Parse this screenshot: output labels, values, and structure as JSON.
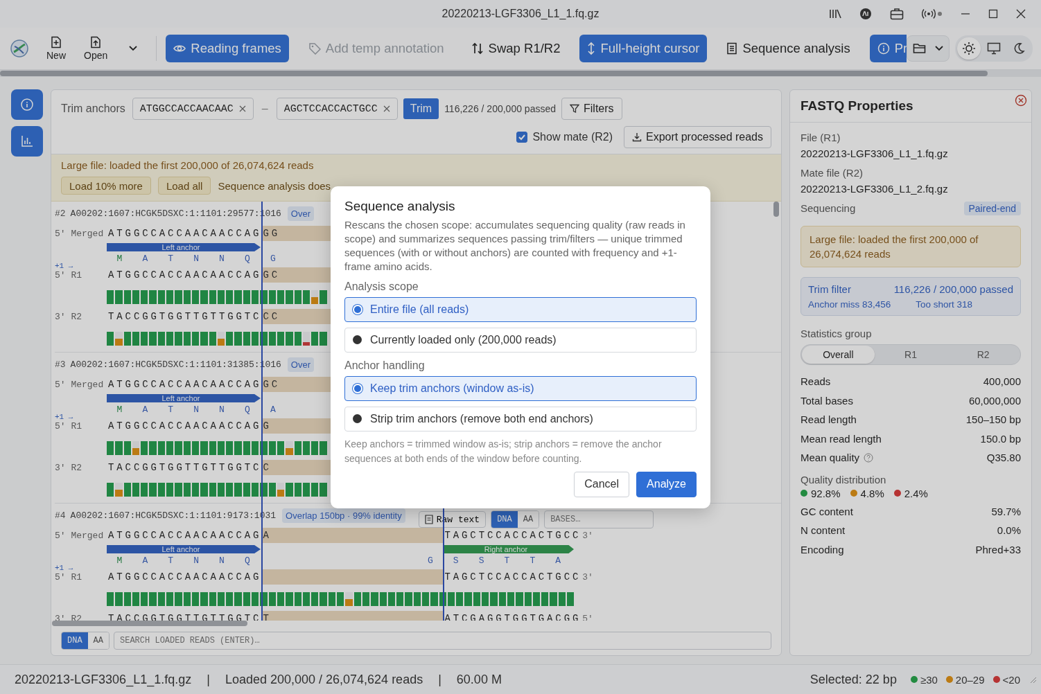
{
  "window": {
    "title": "20220213-LGF3306_L1_1.fq.gz"
  },
  "toolbar": {
    "file_buttons": [
      {
        "label": "New"
      },
      {
        "label": "Open"
      }
    ],
    "actions": [
      {
        "label": "Reading frames",
        "on": true,
        "disabled": false
      },
      {
        "label": "Add temp annotation",
        "on": false,
        "disabled": true
      },
      {
        "label": "Swap R1/R2",
        "on": false,
        "disabled": false
      },
      {
        "label": "Full-height cursor",
        "on": true,
        "disabled": false
      },
      {
        "label": "Sequence analysis",
        "on": false,
        "disabled": false
      },
      {
        "label": "Pr",
        "on": true,
        "disabled": false
      }
    ],
    "themes": [
      {
        "selected": true
      },
      {
        "selected": false
      },
      {
        "selected": false
      }
    ]
  },
  "trim": {
    "label": "Trim anchors",
    "left_anchor": "ATGGCCACCAACAAC",
    "separator": "–",
    "right_anchor": "AGCTCCACCACTGCC",
    "button": "Trim",
    "passed": "116,226 / 200,000 passed",
    "filters": "Filters"
  },
  "show_mate": {
    "label": "Show mate (R2)",
    "checked": true
  },
  "export_button": "Export processed reads",
  "banner": {
    "text": "Large file: loaded the first 200,000 of 26,074,624 reads",
    "buttons": [
      "Load 10% more",
      "Load all"
    ],
    "note": "Sequence analysis does"
  },
  "reads": [
    {
      "number": "#2",
      "name": "A00202:1607:HCGK5DSXC:1:1101:29577:1016",
      "badge": "Over",
      "rows": [
        {
          "kind": "seq",
          "prime": "5′",
          "label": "Merged",
          "bases": "ATGGCCACCAACAACCAG",
          "after": "GG"
        },
        {
          "kind": "anchors",
          "left": "Left anchor"
        },
        {
          "kind": "aa",
          "frame": "+1 →",
          "left": [
            "M",
            "A",
            "T",
            "N",
            "N",
            "Q"
          ],
          "after": [
            "G"
          ]
        },
        {
          "kind": "seq",
          "prime": "5′",
          "label": "R1",
          "bases": "ATGGCCACCAACAACCAG",
          "after": "GC"
        },
        {
          "kind": "quality",
          "bars": [
            {
              "level": 1
            },
            {
              "level": 1
            },
            {
              "level": 1
            },
            {
              "level": 1
            },
            {
              "level": 1
            },
            {
              "level": 1
            },
            {
              "level": 1
            },
            {
              "level": 1
            },
            {
              "level": 1
            },
            {
              "level": 1
            },
            {
              "level": 1
            },
            {
              "level": 1
            },
            {
              "level": 1
            },
            {
              "level": 1
            },
            {
              "level": 1
            },
            {
              "level": 1
            },
            {
              "level": 1
            },
            {
              "level": 1
            },
            {
              "level": 1
            },
            {
              "level": 1
            },
            {
              "level": 1
            },
            {
              "level": 1
            },
            {
              "level": 1
            },
            {
              "level": 1
            },
            {
              "level": 0.5
            },
            {
              "level": 1
            }
          ]
        },
        {
          "kind": "seq",
          "prime": "3′",
          "label": "R2",
          "bases": "TACCGGTGGTTGTTGGTC",
          "after": "CC"
        },
        {
          "kind": "quality",
          "bars": [
            {
              "level": 1
            },
            {
              "level": 0.5
            },
            {
              "level": 1
            },
            {
              "level": 1
            },
            {
              "level": 1
            },
            {
              "level": 1
            },
            {
              "level": 1
            },
            {
              "level": 1
            },
            {
              "level": 1
            },
            {
              "level": 1
            },
            {
              "level": 1
            },
            {
              "level": 1
            },
            {
              "level": 1
            },
            {
              "level": 0.5
            },
            {
              "level": 1
            },
            {
              "level": 1
            },
            {
              "level": 1
            },
            {
              "level": 1
            },
            {
              "level": 1
            },
            {
              "level": 1
            },
            {
              "level": 1
            },
            {
              "level": 1
            },
            {
              "level": 1
            },
            {
              "level": 0.25
            },
            {
              "level": 1
            },
            {
              "level": 1
            }
          ]
        }
      ]
    },
    {
      "number": "#3",
      "name": "A00202:1607:HCGK5DSXC:1:1101:31385:1016",
      "badge": "Over",
      "rows": [
        {
          "kind": "seq",
          "prime": "5′",
          "label": "Merged",
          "bases": "ATGGCCACCAACAACCAG",
          "after": "GC"
        },
        {
          "kind": "anchors",
          "left": "Left anchor"
        },
        {
          "kind": "aa",
          "frame": "+1 →",
          "left": [
            "M",
            "A",
            "T",
            "N",
            "N",
            "Q"
          ],
          "after": [
            "A"
          ]
        },
        {
          "kind": "seq",
          "prime": "5′",
          "label": "R1",
          "bases": "ATGGCCACCAACAACCAG",
          "after": "G"
        },
        {
          "kind": "quality",
          "bars": [
            {
              "level": 1
            },
            {
              "level": 1
            },
            {
              "level": 1
            },
            {
              "level": 0.5
            },
            {
              "level": 1
            },
            {
              "level": 1
            },
            {
              "level": 1
            },
            {
              "level": 1
            },
            {
              "level": 1
            },
            {
              "level": 1
            },
            {
              "level": 1
            },
            {
              "level": 1
            },
            {
              "level": 1
            },
            {
              "level": 1
            },
            {
              "level": 1
            },
            {
              "level": 1
            },
            {
              "level": 1
            },
            {
              "level": 1
            },
            {
              "level": 1
            },
            {
              "level": 1
            },
            {
              "level": 1
            },
            {
              "level": 0.5
            },
            {
              "level": 1
            },
            {
              "level": 1
            },
            {
              "level": 1
            },
            {
              "level": 1
            }
          ]
        },
        {
          "kind": "seq",
          "prime": "3′",
          "label": "R2",
          "bases": "TACCGGTGGTTGTTGGTC",
          "after": "C"
        },
        {
          "kind": "quality",
          "bars": [
            {
              "level": 1
            },
            {
              "level": 0.5
            },
            {
              "level": 1
            },
            {
              "level": 1
            },
            {
              "level": 1
            },
            {
              "level": 1
            },
            {
              "level": 1
            },
            {
              "level": 1
            },
            {
              "level": 1
            },
            {
              "level": 1
            },
            {
              "level": 1
            },
            {
              "level": 1
            },
            {
              "level": 1
            },
            {
              "level": 1
            },
            {
              "level": 1
            },
            {
              "level": 1
            },
            {
              "level": 1
            },
            {
              "level": 1
            },
            {
              "level": 1
            },
            {
              "level": 1
            },
            {
              "level": 0.5
            },
            {
              "level": 1
            },
            {
              "level": 1
            },
            {
              "level": 1
            },
            {
              "level": 1
            },
            {
              "level": 1
            }
          ]
        }
      ]
    },
    {
      "number": "#4",
      "name": "A00202:1607:HCGK5DSXC:1:1101:9173:1031",
      "badge": "Overlap 150bp · 99% identity",
      "tools": {
        "raw_button": "Raw text",
        "modes": [
          {
            "label": "DNA",
            "selected": true
          },
          {
            "label": "AA",
            "selected": false
          }
        ],
        "placeholder": "BASES…"
      },
      "rows": [
        {
          "kind": "seq",
          "prime": "5′",
          "label": "Merged",
          "bases": "ATGGCCACCAACAACCAG",
          "after": "A",
          "tail": "TAGCTCCACCACTGCC",
          "end": "3′"
        },
        {
          "kind": "anchors",
          "left": "Left anchor",
          "right": "Right anchor"
        },
        {
          "kind": "aa",
          "frame": "+1 →",
          "left": [
            "M",
            "A",
            "T",
            "N",
            "N",
            "Q"
          ],
          "right": [
            "G",
            "S",
            "S",
            "T",
            "T",
            "A"
          ]
        },
        {
          "kind": "seq",
          "prime": "5′",
          "label": "R1",
          "bases": "ATGGCCACCAACAACCAG",
          "tail": "TAGCTCCACCACTGCC",
          "end": "3′"
        },
        {
          "kind": "quality",
          "bars": [
            {
              "level": 1
            },
            {
              "level": 1
            },
            {
              "level": 1
            },
            {
              "level": 1
            },
            {
              "level": 1
            },
            {
              "level": 1
            },
            {
              "level": 1
            },
            {
              "level": 1
            },
            {
              "level": 1
            },
            {
              "level": 1
            },
            {
              "level": 1
            },
            {
              "level": 1
            },
            {
              "level": 1
            },
            {
              "level": 1
            },
            {
              "level": 1
            },
            {
              "level": 1
            },
            {
              "level": 1
            },
            {
              "level": 1
            },
            {
              "level": 1
            },
            {
              "level": 1
            },
            {
              "level": 1
            },
            {
              "level": 1
            },
            {
              "level": 1
            },
            {
              "level": 1
            },
            {
              "level": 1
            },
            {
              "level": 1
            },
            {
              "level": 1
            },
            {
              "level": 1
            },
            {
              "level": 0.5
            },
            {
              "level": 1
            },
            {
              "level": 1
            },
            {
              "level": 1
            },
            {
              "level": 1
            },
            {
              "level": 1
            },
            {
              "level": 1
            },
            {
              "level": 1
            },
            {
              "level": 1
            },
            {
              "level": 1
            },
            {
              "level": 1
            },
            {
              "level": 1
            },
            {
              "level": 1
            },
            {
              "level": 1
            },
            {
              "level": 1
            },
            {
              "level": 1
            },
            {
              "level": 1
            },
            {
              "level": 1
            },
            {
              "level": 1
            },
            {
              "level": 1
            },
            {
              "level": 1
            },
            {
              "level": 1
            },
            {
              "level": 1
            },
            {
              "level": 1
            },
            {
              "level": 1
            },
            {
              "level": 1
            },
            {
              "level": 1
            }
          ]
        },
        {
          "kind": "seq",
          "prime": "3′",
          "label": "R2",
          "bases": "TACCGGTGGTTGTTGGTC",
          "after": "T",
          "tail": "ATCGAGGTGGTGACGG",
          "end": "5′"
        }
      ]
    }
  ],
  "search_bar": {
    "modes": [
      {
        "label": "DNA",
        "selected": true
      },
      {
        "label": "AA",
        "selected": false
      }
    ],
    "placeholder": "SEARCH LOADED READS (ENTER)…"
  },
  "properties": {
    "title": "FASTQ Properties",
    "files": [
      {
        "label": "File (R1)",
        "value": "20220213-LGF3306_L1_1.fq.gz"
      },
      {
        "label": "Mate file (R2)",
        "value": "20220213-LGF3306_L1_2.fq.gz"
      }
    ],
    "sequencing": {
      "label": "Sequencing",
      "badge": "Paired-end"
    },
    "notice": "Large file: loaded the first 200,000 of 26,074,624 reads",
    "trim_filter": {
      "label": "Trim filter",
      "passed": "116,226 / 200,000 passed",
      "anchor_miss": "Anchor miss 83,456",
      "too_short": "Too short 318"
    },
    "group": {
      "label": "Statistics group",
      "options": [
        {
          "label": "Overall",
          "selected": true
        },
        {
          "label": "R1",
          "selected": false
        },
        {
          "label": "R2",
          "selected": false
        }
      ]
    },
    "stats": [
      {
        "label": "Reads",
        "value": "400,000",
        "help": false
      },
      {
        "label": "Total bases",
        "value": "60,000,000",
        "help": false
      },
      {
        "label": "Read length",
        "value": "150–150 bp",
        "help": false
      },
      {
        "label": "Mean read length",
        "value": "150.0 bp",
        "help": false
      },
      {
        "label": "Mean quality",
        "value": "Q35.80",
        "help": true
      }
    ],
    "quality_distribution": {
      "label": "Quality distribution",
      "items": [
        {
          "value": "92.8%",
          "color": "#238b41"
        },
        {
          "value": "4.8%",
          "color": "#bb7b14"
        },
        {
          "value": "2.4%",
          "color": "#b63333"
        }
      ]
    },
    "stats_more": [
      {
        "label": "GC content",
        "value": "59.7%"
      },
      {
        "label": "N content",
        "value": "0.0%"
      },
      {
        "label": "Encoding",
        "value": "Phred+33"
      }
    ]
  },
  "dialog": {
    "title": "Sequence analysis",
    "description": "Rescans the chosen scope: accumulates sequencing quality (raw reads in scope) and summarizes sequences passing trim/filters — unique trimmed sequences (with or without anchors) are counted with frequency and +1-frame amino acids.",
    "groups": [
      {
        "label": "Analysis scope",
        "options": [
          {
            "label": "Entire file (all reads)",
            "selected": true
          },
          {
            "label": "Currently loaded only (200,000 reads)",
            "selected": false
          }
        ]
      },
      {
        "label": "Anchor handling",
        "options": [
          {
            "label": "Keep trim anchors (window as-is)",
            "selected": true
          },
          {
            "label": "Strip trim anchors (remove both end anchors)",
            "selected": false
          }
        ]
      }
    ],
    "note": "Keep anchors = trimmed window as-is; strip anchors = remove the anchor sequences at both ends of the window before counting.",
    "buttons": [
      {
        "label": "Cancel",
        "kind": "secondary"
      },
      {
        "label": "Analyze",
        "kind": "primary"
      }
    ]
  },
  "status_bar": {
    "left": [
      "20220213-LGF3306_L1_1.fq.gz",
      "|",
      "Loaded 200,000 / 26,074,624 reads",
      "|",
      "60.00 M"
    ],
    "selected": "Selected: 22 bp",
    "legend": [
      {
        "label": "≥30",
        "color": "#238b41"
      },
      {
        "label": "20–29",
        "color": "#bb7b14"
      },
      {
        "label": "<20",
        "color": "#b63333"
      }
    ]
  }
}
